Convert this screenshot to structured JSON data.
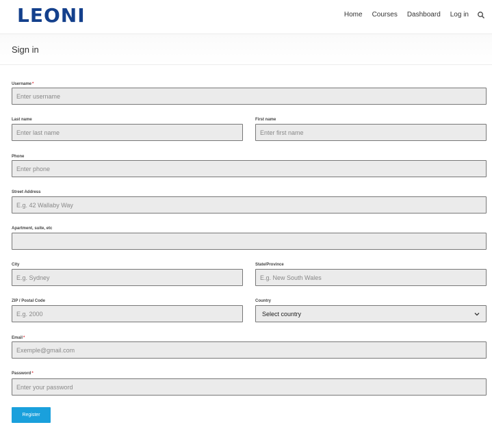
{
  "header": {
    "logo": "LEONI",
    "nav": [
      "Home",
      "Courses",
      "Dashboard",
      "Log in"
    ]
  },
  "page": {
    "title": "Sign in"
  },
  "form": {
    "username": {
      "label": "Username",
      "placeholder": "Enter username",
      "required": true
    },
    "last_name": {
      "label": "Last name",
      "placeholder": "Enter last name"
    },
    "first_name": {
      "label": "First name",
      "placeholder": "Enter first name"
    },
    "phone": {
      "label": "Phone",
      "placeholder": "Enter phone"
    },
    "street": {
      "label": "Street Address",
      "placeholder": "E.g. 42 Wallaby Way"
    },
    "apartment": {
      "label": "Apartment, suite, etc",
      "placeholder": ""
    },
    "city": {
      "label": "City",
      "placeholder": "E.g. Sydney"
    },
    "state": {
      "label": "State/Province",
      "placeholder": "E.g. New South Wales"
    },
    "zip": {
      "label": "ZIP / Postal Code",
      "placeholder": "E.g. 2000"
    },
    "country": {
      "label": "Country",
      "value": "Select country"
    },
    "email": {
      "label": "Email",
      "placeholder": "Exemple@gmail.com",
      "required": true
    },
    "password": {
      "label": "Password",
      "placeholder": "Enter your password",
      "required": true
    },
    "register_label": "Register"
  },
  "colors": {
    "logo": "#14408c",
    "button": "#1aa0dc",
    "required": "#d9363e"
  }
}
